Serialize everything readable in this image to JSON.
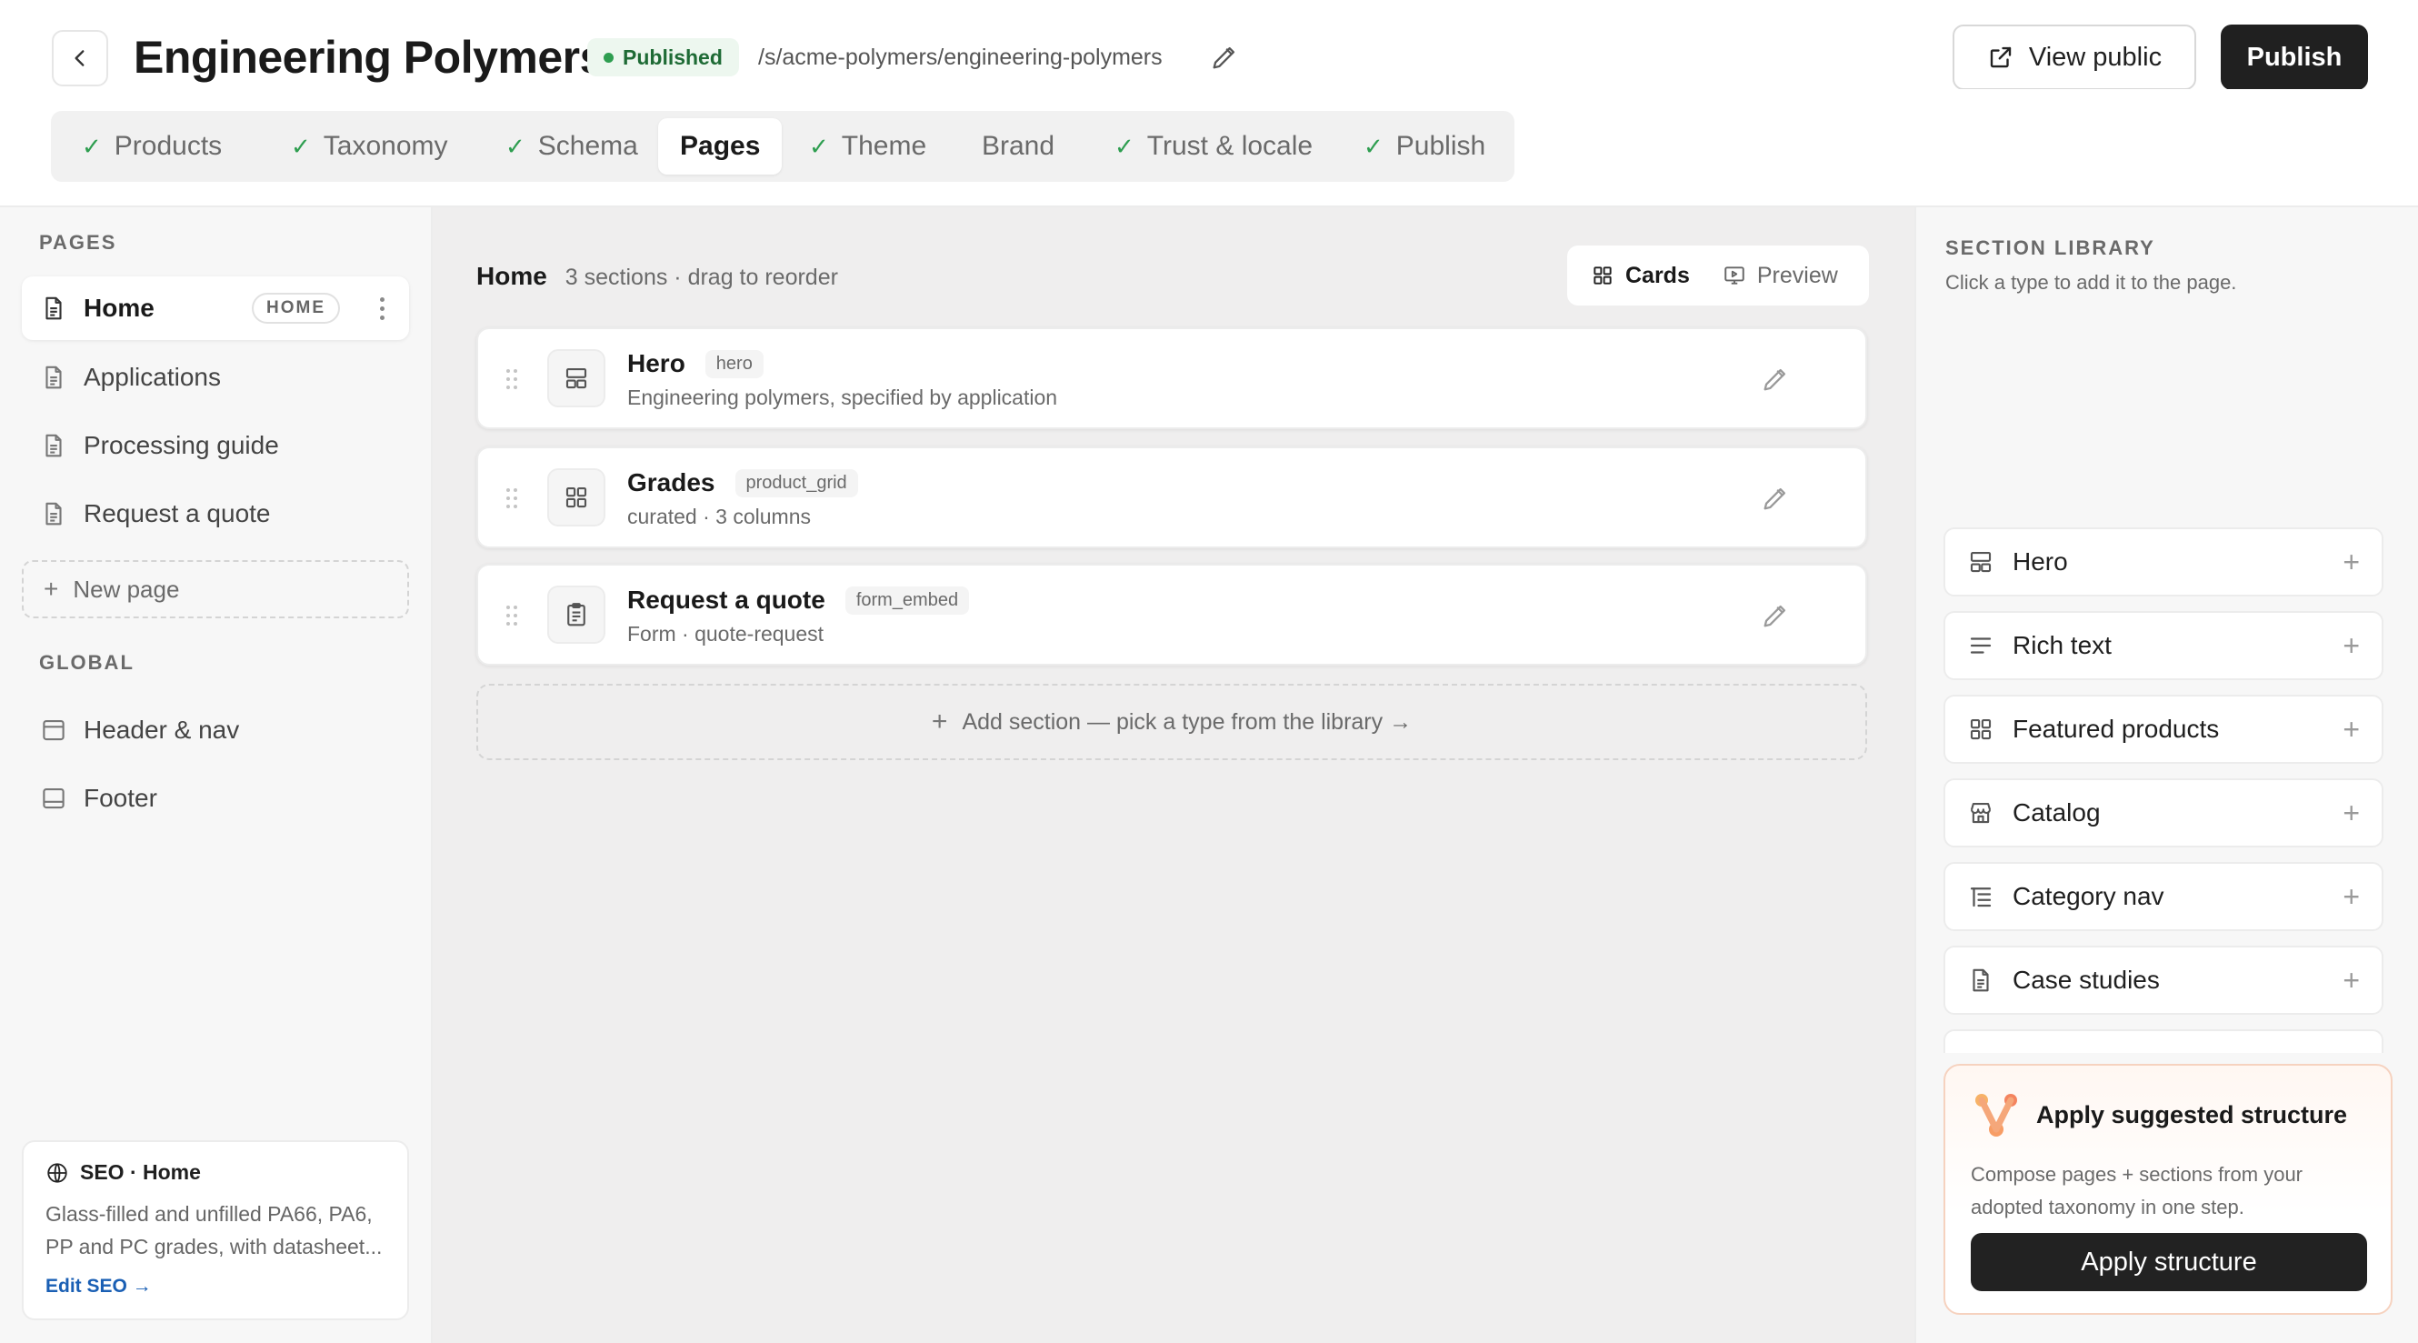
{
  "header": {
    "title": "Engineering Polymers",
    "status": "Published",
    "url_path": "/s/acme-polymers/engineering-polymers",
    "view_public_label": "View public",
    "publish_label": "Publish"
  },
  "tabs": [
    {
      "label": "Products",
      "checked": true,
      "active": false
    },
    {
      "label": "Taxonomy",
      "checked": true,
      "active": false
    },
    {
      "label": "Schema",
      "checked": true,
      "active": false
    },
    {
      "label": "Pages",
      "checked": false,
      "active": true
    },
    {
      "label": "Theme",
      "checked": true,
      "active": false
    },
    {
      "label": "Brand",
      "checked": false,
      "active": false
    },
    {
      "label": "Trust & locale",
      "checked": true,
      "active": false
    },
    {
      "label": "Publish",
      "checked": true,
      "active": false
    }
  ],
  "sidebar": {
    "pages_label": "PAGES",
    "pages": [
      {
        "label": "Home",
        "badge": "HOME",
        "active": true
      },
      {
        "label": "Applications"
      },
      {
        "label": "Processing guide"
      },
      {
        "label": "Request a quote"
      }
    ],
    "new_page_label": "New page",
    "global_label": "GLOBAL",
    "global_items": [
      {
        "label": "Header & nav",
        "icon": "header-icon"
      },
      {
        "label": "Footer",
        "icon": "footer-icon"
      }
    ],
    "seo": {
      "title": "SEO · Home",
      "description": "Glass-filled and unfilled PA66, PA6, PP and PC grades, with datasheet...",
      "link": "Edit SEO →"
    }
  },
  "main": {
    "page_name": "Home",
    "meta": "3 sections · drag to reorder",
    "view_options": [
      {
        "label": "Cards",
        "active": true
      },
      {
        "label": "Preview",
        "active": false
      }
    ],
    "sections": [
      {
        "title": "Hero",
        "type": "hero",
        "subtitle": "Engineering polymers, specified by application",
        "icon": "hero-layout-icon"
      },
      {
        "title": "Grades",
        "type": "product_grid",
        "subtitle": "curated · 3 columns",
        "icon": "grid-icon"
      },
      {
        "title": "Request a quote",
        "type": "form_embed",
        "subtitle": "Form · quote-request",
        "icon": "clipboard-icon"
      }
    ],
    "add_section_label": "Add section — pick a type from the library →"
  },
  "library": {
    "title": "SECTION LIBRARY",
    "subtitle": "Click a type to add it to the page.",
    "items": [
      {
        "label": "Hero",
        "icon": "hero-layout-icon"
      },
      {
        "label": "Rich text",
        "icon": "text-lines-icon"
      },
      {
        "label": "Featured products",
        "icon": "grid-icon"
      },
      {
        "label": "Catalog",
        "icon": "store-icon"
      },
      {
        "label": "Category nav",
        "icon": "list-tree-icon"
      },
      {
        "label": "Case studies",
        "icon": "document-icon"
      }
    ],
    "suggest": {
      "title": "Apply suggested structure",
      "description": "Compose pages + sections from your adopted taxonomy in one step.",
      "button": "Apply structure"
    }
  },
  "colors": {
    "accent_dark": "#202020",
    "check_green": "#2e9e50",
    "link_blue": "#1a5fb4",
    "suggest_border": "#f6d2bf"
  }
}
